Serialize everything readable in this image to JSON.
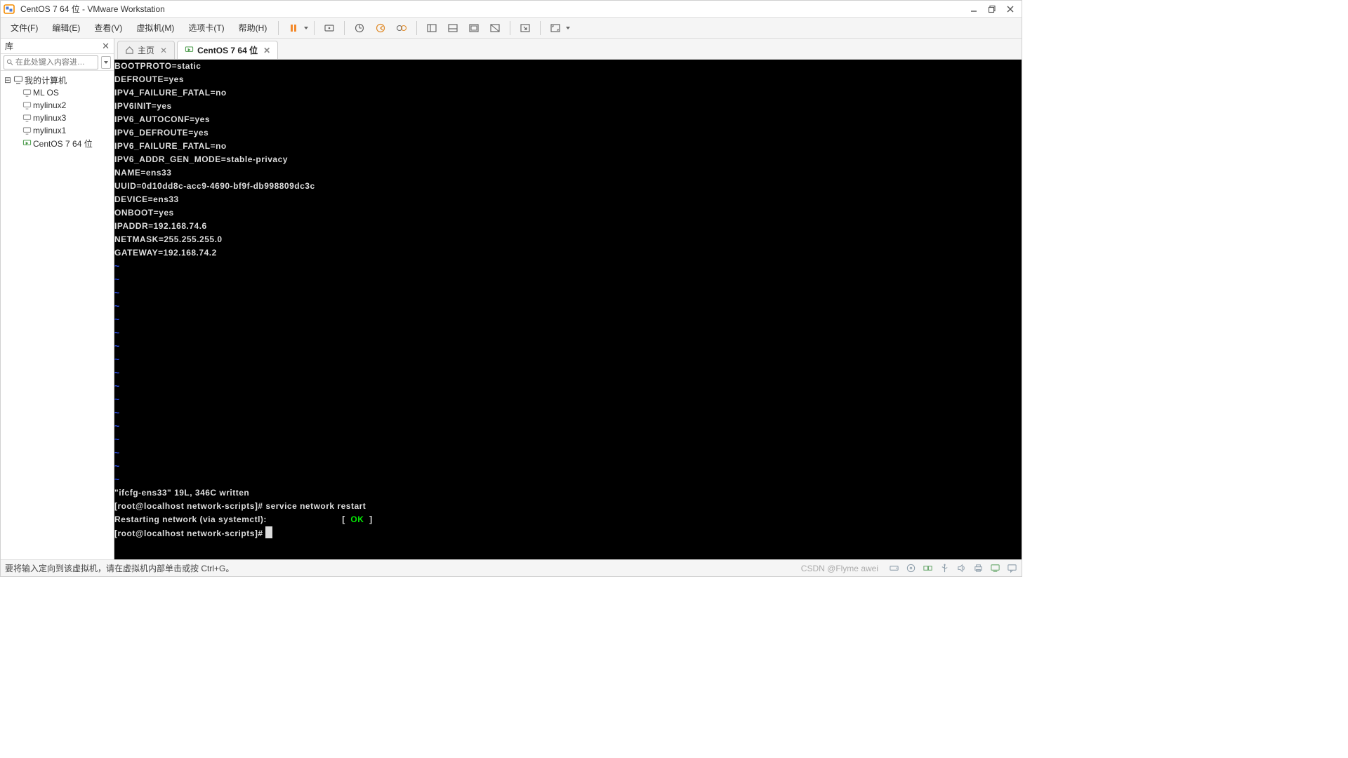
{
  "title": "CentOS 7 64 位 - VMware Workstation",
  "menu": {
    "file": "文件(F)",
    "edit": "编辑(E)",
    "view": "查看(V)",
    "vm": "虚拟机(M)",
    "tabs_menu": "选项卡(T)",
    "help": "帮助(H)"
  },
  "sidebar": {
    "header": "库",
    "search_placeholder": "在此处键入内容进…",
    "root": "我的计算机",
    "items": [
      "ML OS",
      "mylinux2",
      "mylinux3",
      "mylinux1",
      "CentOS 7 64 位"
    ]
  },
  "tabs": [
    {
      "label": "主页",
      "active": false
    },
    {
      "label": "CentOS 7 64 位",
      "active": true
    }
  ],
  "terminal": {
    "lines": [
      "BOOTPROTO=static",
      "DEFROUTE=yes",
      "IPV4_FAILURE_FATAL=no",
      "IPV6INIT=yes",
      "IPV6_AUTOCONF=yes",
      "IPV6_DEFROUTE=yes",
      "IPV6_FAILURE_FATAL=no",
      "IPV6_ADDR_GEN_MODE=stable-privacy",
      "NAME=ens33",
      "UUID=0d10dd8c-acc9-4690-bf9f-db998809dc3c",
      "DEVICE=ens33",
      "ONBOOT=yes",
      "IPADDR=192.168.74.6",
      "NETMASK=255.255.255.0",
      "GATEWAY=192.168.74.2"
    ],
    "tilde": "~",
    "tilde_count": 17,
    "written": "\"ifcfg-ens33\" 19L, 346C written",
    "cmd_prompt": "[root@localhost network-scripts]# ",
    "cmd": "service network restart",
    "restart_line": "Restarting network (via systemctl):                            [  ",
    "ok": "OK",
    "restart_close": "  ]",
    "final_prompt": "[root@localhost network-scripts]# "
  },
  "status": {
    "text": "要将输入定向到该虚拟机，请在虚拟机内部单击或按 Ctrl+G。",
    "watermark": "CSDN @Flyme awei"
  }
}
